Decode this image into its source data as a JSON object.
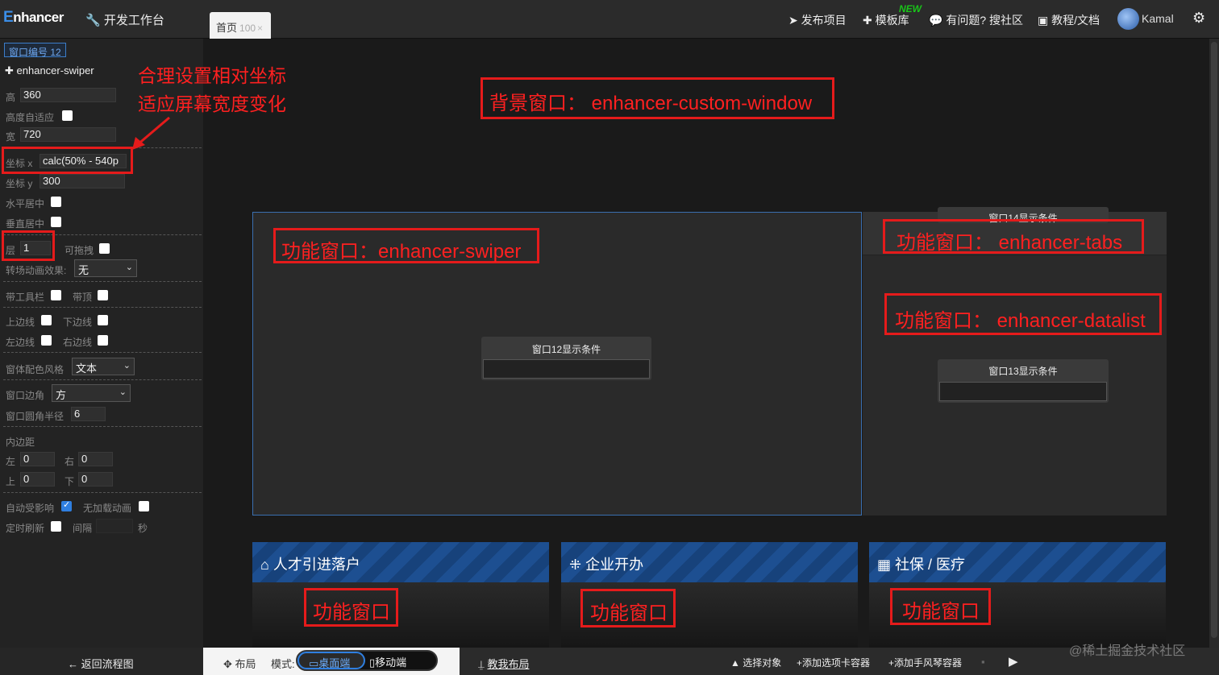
{
  "topbar": {
    "logo_mark": "E",
    "logo_rest": "nhancer",
    "dev_workbench": "开发工作台",
    "home_tab": "首页",
    "home_tab_count": "100",
    "home_tab_close": "×",
    "nav": {
      "publish": "发布项目",
      "templates": "模板库",
      "new_badge": "NEW",
      "community": "有问题? 搜社区",
      "docs": "教程/文档"
    },
    "user_name": "Kamal"
  },
  "props": {
    "window_no": "窗口编号 12",
    "component": "enhancer-swiper",
    "height_label": "高",
    "height_value": "360",
    "auto_height_label": "高度自适应",
    "width_label": "宽",
    "width_value": "720",
    "coord_x_label": "坐标 x",
    "coord_x_value": "calc(50% - 540p",
    "coord_y_label": "坐标 y",
    "coord_y_value": "300",
    "h_center_label": "水平居中",
    "v_center_label": "垂直居中",
    "layer_label": "层",
    "layer_value": "1",
    "draggable_label": "可拖拽",
    "transition_label": "转场动画效果:",
    "transition_value": "无",
    "toolbar_label": "带工具栏",
    "top_label": "带顶",
    "border_top_label": "上边线",
    "border_bottom_label": "下边线",
    "border_left_label": "左边线",
    "border_right_label": "右边线",
    "color_style_label": "窗体配色风格",
    "color_style_value": "文本",
    "corner_label": "窗口边角",
    "corner_value": "方",
    "radius_label": "窗口圆角半径",
    "radius_value": "6",
    "padding_label": "内边距",
    "pad_left_label": "左",
    "pad_left_value": "0",
    "pad_right_label": "右",
    "pad_right_value": "0",
    "pad_top_label": "上",
    "pad_top_value": "0",
    "pad_bottom_label": "下",
    "pad_bottom_value": "0",
    "auto_affect_label": "自动受影响",
    "auto_affect_checked": true,
    "no_anim_label": "无加载动画",
    "timer_refresh_label": "定时刷新",
    "interval_label": "间隔",
    "seconds_label": "秒"
  },
  "canvas": {
    "cond12": "窗口12显示条件",
    "cond13": "窗口13显示条件",
    "cond14": "窗口14显示条件",
    "cards": [
      {
        "title": "人才引进落户",
        "body": "功能窗口"
      },
      {
        "title": "企业开办",
        "body": "功能窗口"
      },
      {
        "title": "社保 / 医疗",
        "body": "功能窗口"
      }
    ]
  },
  "annotations": {
    "coord_note_line1": "合理设置相对坐标",
    "coord_note_line2": "适应屏幕宽度变化",
    "background_window": "背景窗口： enhancer-custom-window",
    "swiper_window": "功能窗口：enhancer-swiper",
    "tabs_window": "功能窗口： enhancer-tabs",
    "datalist_window": "功能窗口： enhancer-datalist"
  },
  "bottombar": {
    "back_flow": "返回流程图",
    "layout": "布局",
    "mode_label": "模式:",
    "desktop": "桌面端",
    "mobile": "移动端",
    "teach_layout": "教我布局",
    "select_object": "选择对象",
    "add_tabs_container": "+添加选项卡容器",
    "add_accordion_container": "+添加手风琴容器"
  },
  "watermark": "@稀土掘金技术社区",
  "colors": {
    "accent": "#2f7fe0",
    "annotation_red": "#e51b1b",
    "card_header": "#1d4f91"
  }
}
